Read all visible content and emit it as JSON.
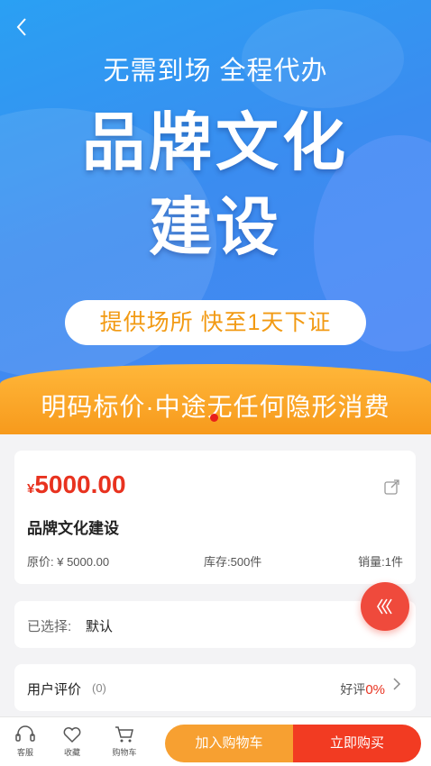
{
  "banner": {
    "subtitle": "无需到场 全程代办",
    "title_line1": "品牌文化",
    "title_line2": "建设",
    "pill": "提供场所 快至1天下证",
    "strip": "明码标价·中途无任何隐形消费"
  },
  "product": {
    "currency": "¥",
    "price": "5000.00",
    "name": "品牌文化建设",
    "original_price": "原价: ¥ 5000.00",
    "stock": "库存:500件",
    "sales": "销量:1件"
  },
  "selection": {
    "label": "已选择:",
    "value": "默认"
  },
  "reviews": {
    "label": "用户评价",
    "count": "(0)",
    "good_label": "好评",
    "good_pct": "0%"
  },
  "bottom_bar": {
    "service_label": "客服",
    "favorite_label": "收藏",
    "cart_label": "购物车",
    "add_to_cart": "加入购物车",
    "buy_now": "立即购买"
  },
  "icons": {
    "back": "chevron-left-icon",
    "share": "share-icon",
    "float": "chevron-left-double-icon",
    "service": "headset-icon",
    "favorite": "heart-icon",
    "cart": "cart-icon"
  },
  "colors": {
    "price_red": "#e8321f",
    "banner_blue": "#3b8cf0",
    "strip_orange": "#f79a1c",
    "cart_button": "#f7a031",
    "buy_button": "#f23b22"
  }
}
